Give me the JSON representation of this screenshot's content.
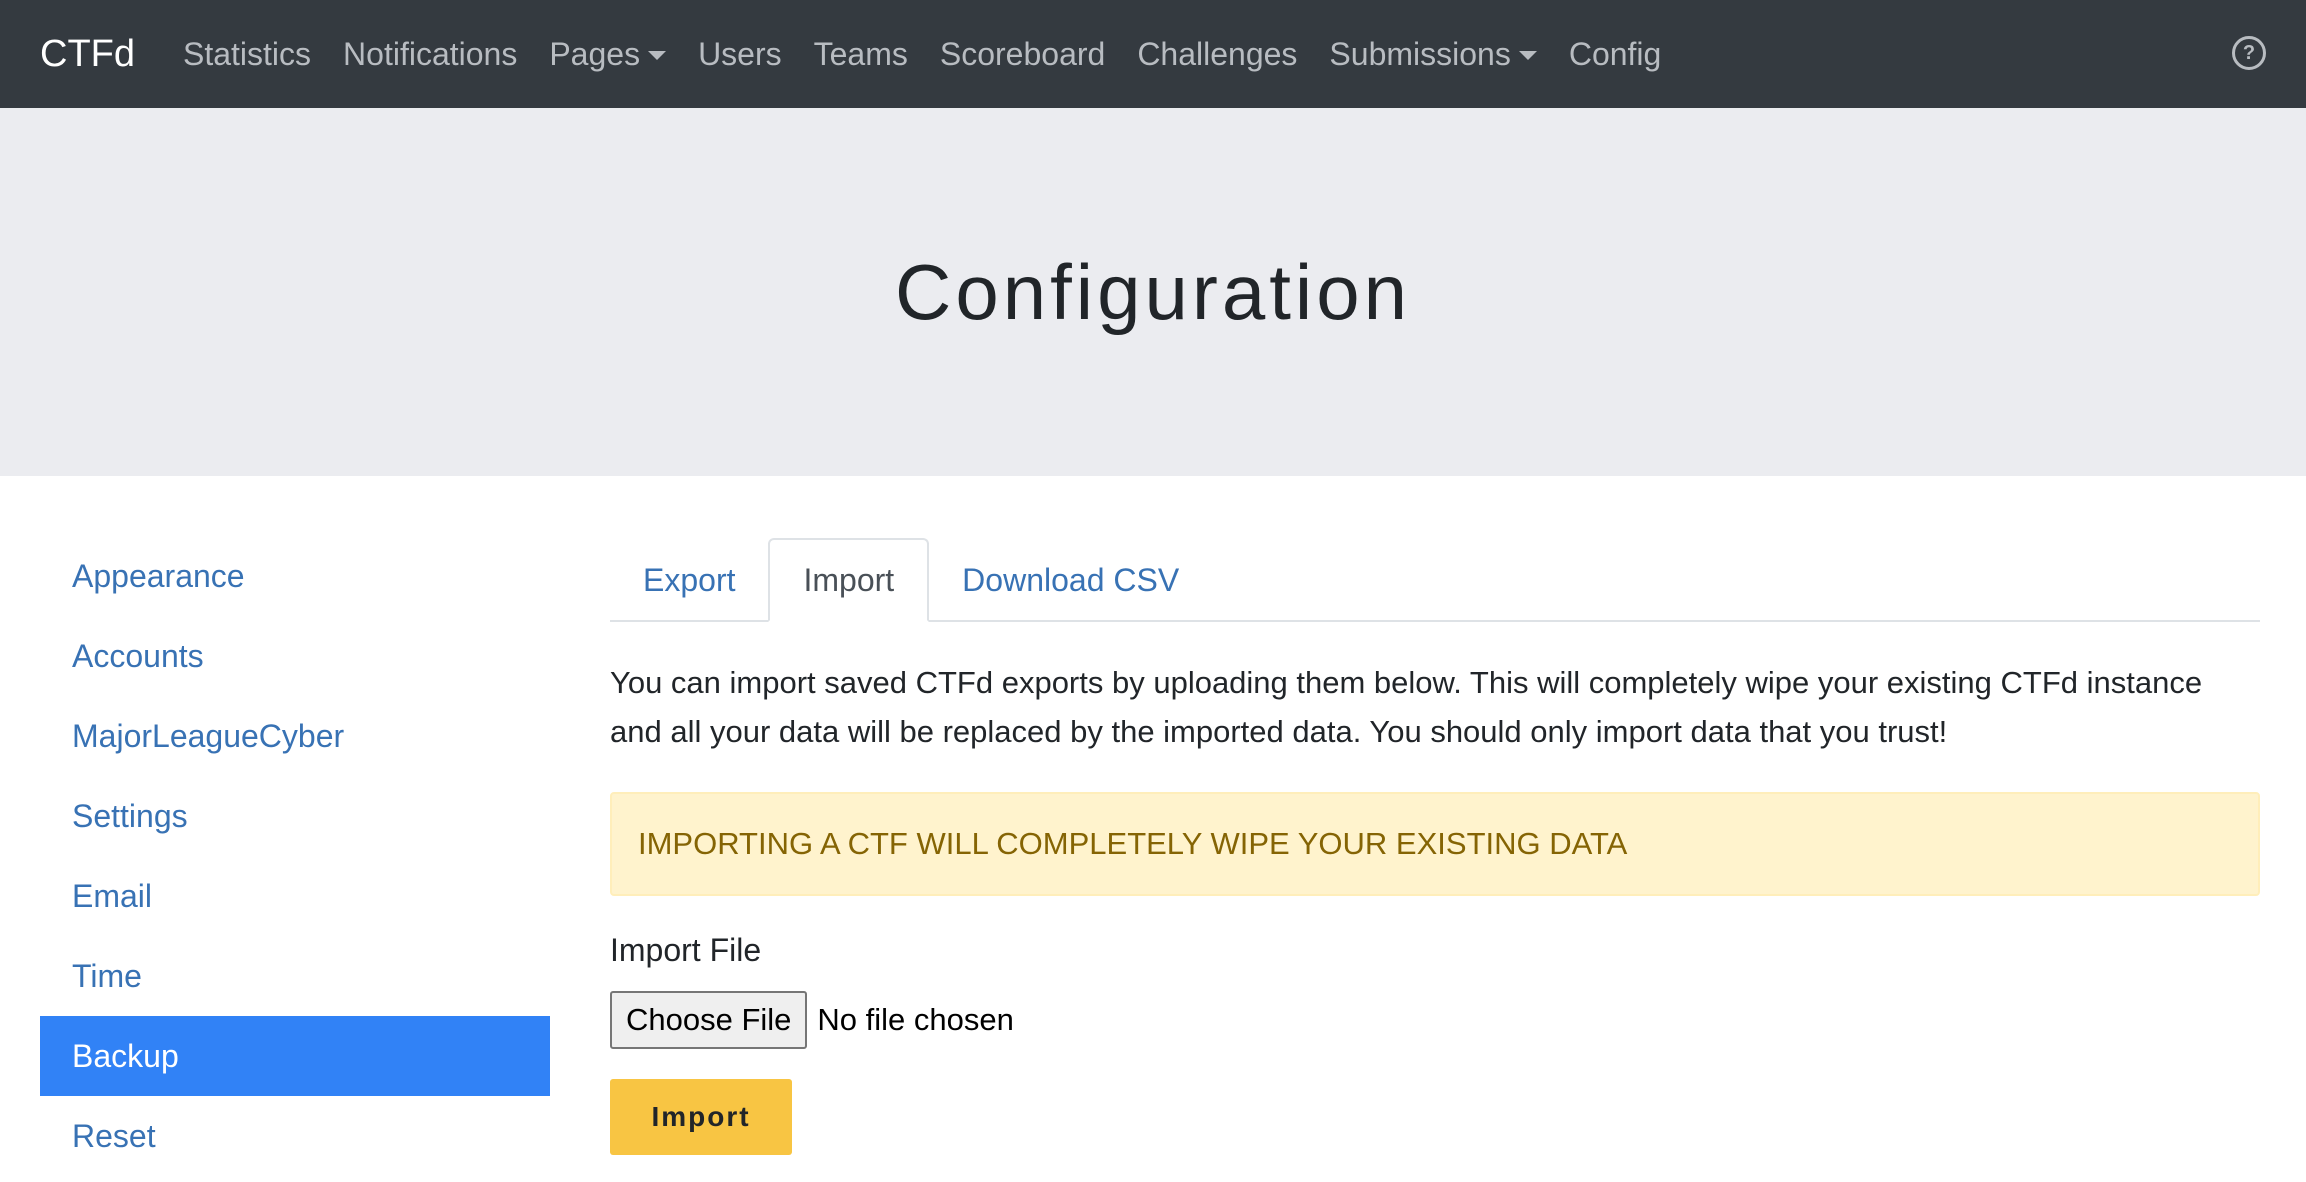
{
  "navbar": {
    "brand": "CTFd",
    "items": [
      {
        "label": "Statistics",
        "dropdown": false
      },
      {
        "label": "Notifications",
        "dropdown": false
      },
      {
        "label": "Pages",
        "dropdown": true
      },
      {
        "label": "Users",
        "dropdown": false
      },
      {
        "label": "Teams",
        "dropdown": false
      },
      {
        "label": "Scoreboard",
        "dropdown": false
      },
      {
        "label": "Challenges",
        "dropdown": false
      },
      {
        "label": "Submissions",
        "dropdown": true
      },
      {
        "label": "Config",
        "dropdown": false
      }
    ],
    "help_icon": "question-circle-icon",
    "help_glyph": "?"
  },
  "header": {
    "title": "Configuration"
  },
  "sidebar": {
    "items": [
      {
        "label": "Appearance",
        "active": false
      },
      {
        "label": "Accounts",
        "active": false
      },
      {
        "label": "MajorLeagueCyber",
        "active": false
      },
      {
        "label": "Settings",
        "active": false
      },
      {
        "label": "Email",
        "active": false
      },
      {
        "label": "Time",
        "active": false
      },
      {
        "label": "Backup",
        "active": true
      },
      {
        "label": "Reset",
        "active": false
      }
    ]
  },
  "main": {
    "tabs": [
      {
        "label": "Export",
        "active": false
      },
      {
        "label": "Import",
        "active": true
      },
      {
        "label": "Download CSV",
        "active": false
      }
    ],
    "description": "You can import saved CTFd exports by uploading them below. This will completely wipe your existing CTFd instance and all your data will be replaced by the imported data. You should only import data that you trust!",
    "alert": "IMPORTING A CTF WILL COMPLETELY WIPE YOUR EXISTING DATA",
    "import_label": "Import File",
    "choose_file_label": "Choose File",
    "file_status": "No file chosen",
    "import_button": "Import"
  },
  "colors": {
    "navbar_bg": "#343a40",
    "jumbotron_bg": "#ebecf0",
    "link": "#3872b4",
    "active_sidebar": "#3182f6",
    "alert_bg": "#fff3cd",
    "alert_text": "#856404",
    "import_button_bg": "#f8c543"
  }
}
